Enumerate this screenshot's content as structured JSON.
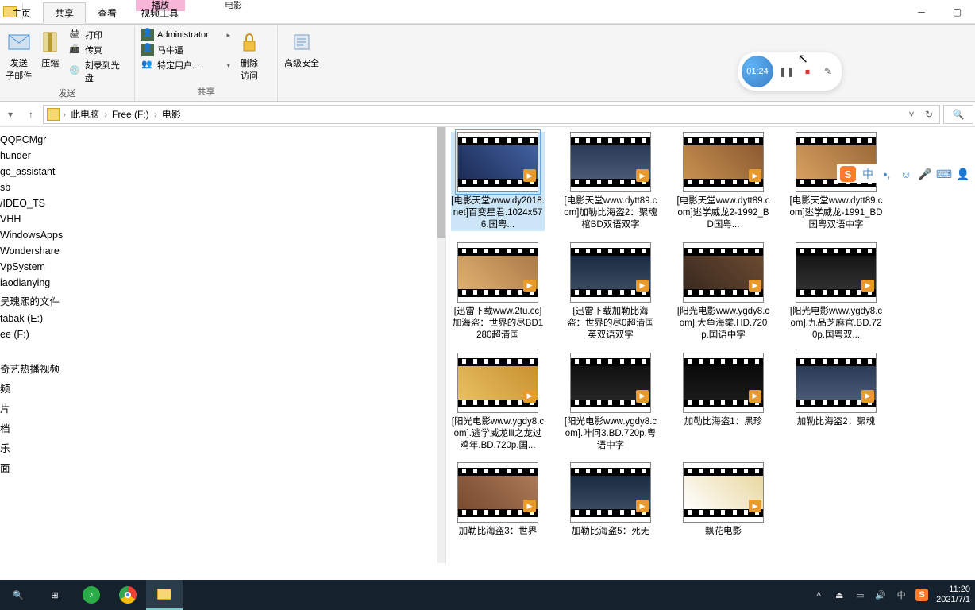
{
  "ribbon_tabs": {
    "home": "主页",
    "share": "共享",
    "view": "查看",
    "video_tools": "视频工具",
    "play_ctx": "播放",
    "movie_ctx": "电影"
  },
  "ribbon": {
    "send_group": "发送",
    "send_big": "发送",
    "send_sub": "子邮件",
    "compress": "压缩",
    "print": "打印",
    "fax": "传真",
    "burn": "刻录到光盘",
    "share_group": "共享",
    "admin": "Administrator",
    "maniu": "马牛逼",
    "special": "特定用户...",
    "delete": "删除",
    "access": "访问",
    "advsec": "高级安全"
  },
  "breadcrumb": {
    "pc": "此电脑",
    "drive": "Free (F:)",
    "folder": "电影"
  },
  "tree": [
    "QQPCMgr",
    "hunder",
    "gc_assistant",
    "sb",
    "/IDEO_TS",
    "VHH",
    "WindowsApps",
    "Wondershare",
    "VpSystem",
    "iaodianying",
    "吴瑰熙的文件",
    "tabak (E:)",
    "ee (F:)",
    "",
    "奇艺热播视频",
    "频",
    "片",
    "档",
    "乐",
    "面"
  ],
  "files": [
    {
      "name": "[电影天堂www.dy2018.net]百变星君.1024x576.国粤...",
      "bg": "linear-gradient(45deg,#1b2b55,#4262a0)"
    },
    {
      "name": "[电影天堂www.dytt89.com]加勒比海盗2：聚魂棺BD双语双字",
      "bg": "linear-gradient(#2a3a55,#4a5a75)"
    },
    {
      "name": "[电影天堂www.dytt89.com]逃学威龙2-1992_BD国粤...",
      "bg": "linear-gradient(45deg,#c89050,#8a5a30)"
    },
    {
      "name": "[电影天堂www.dytt89.com]逃学威龙-1991_BD国粤双语中字",
      "bg": "linear-gradient(45deg,#d8a060,#9a6a38)"
    },
    {
      "name": "[迅雷下载www.2tu.cc]加海盗：世界的尽BD1280超清国",
      "bg": "linear-gradient(45deg,#e0b070,#aa7a48)"
    },
    {
      "name": "[迅雷下载加勒比海盗：世界的尽0超清国英双语双字",
      "bg": "linear-gradient(#1a2a40,#3a4a60)"
    },
    {
      "name": "[阳光电影www.ygdy8.com].大鱼海棠.HD.720p.国语中字",
      "bg": "linear-gradient(45deg,#3a2a20,#6a4a30)"
    },
    {
      "name": "[阳光电影www.ygdy8.com].九品芝麻官.BD.720p.国粤双...",
      "bg": "linear-gradient(#151515,#303030)"
    },
    {
      "name": "[阳光电影www.ygdy8.com].逃学威龙Ⅲ之龙过鸡年.BD.720p.国...",
      "bg": "linear-gradient(45deg,#e8c060,#c89030)"
    },
    {
      "name": "[阳光电影www.ygdy8.com].叶问3.BD.720p.粤语中字",
      "bg": "linear-gradient(#101010,#252525)"
    },
    {
      "name": "加勒比海盗1：黑珍",
      "bg": "linear-gradient(#0a0a0a,#1a1a1a)"
    },
    {
      "name": "加勒比海盗2：聚魂",
      "bg": "linear-gradient(#2a3a55,#4a5a75)"
    },
    {
      "name": "加勒比海盗3：世界",
      "bg": "linear-gradient(45deg,#7a4a30,#aa7a58)"
    },
    {
      "name": "加勒比海盗5：死无",
      "bg": "linear-gradient(#1a2a40,#3a4a60)"
    },
    {
      "name": "飘花电影",
      "bg": "linear-gradient(45deg,#fff,#e8d8a0)"
    }
  ],
  "recorder": {
    "time": "01:24"
  },
  "ime": {
    "lang": "中"
  },
  "taskbar": {
    "time": "11:20",
    "date": "2021/7/1",
    "ime": "中"
  }
}
